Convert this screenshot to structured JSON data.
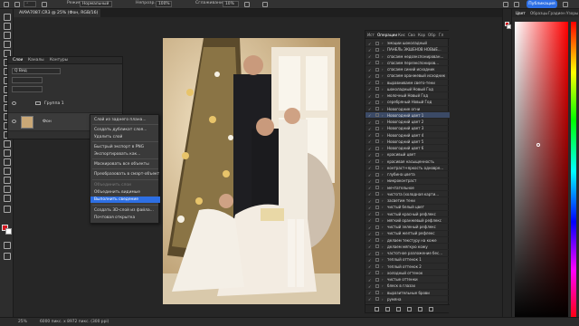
{
  "optionsbar": {
    "mode_label": "Режим:",
    "mode_value": "Нормальный",
    "opacity_label": "Непрозр.:",
    "opacity_value": "100%",
    "smooth_label": "Сглаживание:",
    "smooth_value": "10%",
    "publish_label": "Публикация"
  },
  "document": {
    "tab_title": "AV9A7087.CR3 @ 25% (Фон, RGB/16) *"
  },
  "layers_panel": {
    "tabs": [
      "Слои",
      "Каналы",
      "Контуры"
    ],
    "filter": "Q Вид",
    "rows": [
      {
        "name": "Группа 1"
      },
      {
        "name": "Фон"
      }
    ]
  },
  "context_menu": {
    "items": [
      {
        "label": "Слой из заднего плана...",
        "disabled": false
      },
      {
        "label": "Создать дубликат слоя...",
        "disabled": false
      },
      {
        "label": "Удалить слой",
        "disabled": false
      },
      {
        "label": "Быстрый экспорт в PNG",
        "disabled": false
      },
      {
        "label": "Экспортировать как...",
        "disabled": false
      },
      {
        "label": "Маскировать все объекты",
        "disabled": false
      },
      {
        "label": "Преобразовать в смарт-объект",
        "disabled": false
      },
      {
        "label": "Объединить слои",
        "disabled": true
      },
      {
        "label": "Объединить видимые",
        "disabled": false
      },
      {
        "label": "Выполнить сведение",
        "disabled": false,
        "highlighted": true
      },
      {
        "label": "Создать 3D-слой из файла...",
        "disabled": false
      },
      {
        "label": "Почтовая открытка",
        "disabled": false
      }
    ]
  },
  "actions_panel": {
    "tabs": [
      "Ист",
      "Операции",
      "Кис",
      "Сво",
      "Кор",
      "Обр",
      "Гл"
    ],
    "items": [
      {
        "label": "эмоции шоколадный",
        "arrow": "›",
        "selected": false
      },
      {
        "label": "ПАНЕЛЬ ЭКШЕНОВ НОВЫЕ...",
        "arrow": "⌄",
        "selected": false
      },
      {
        "label": "спасаем недоэкспонирован...",
        "arrow": "›",
        "selected": false
      },
      {
        "label": "спасаем переэкспониров...",
        "arrow": "›",
        "selected": false
      },
      {
        "label": "спасаем синий исходник",
        "arrow": "›",
        "selected": false
      },
      {
        "label": "спасаем оранжевый исходник",
        "arrow": "›",
        "selected": false
      },
      {
        "label": "выравниваем свето-тени",
        "arrow": "›",
        "selected": false
      },
      {
        "label": "шоколадный Новый Год",
        "arrow": "›",
        "selected": false
      },
      {
        "label": "молочный Новый Год",
        "arrow": "›",
        "selected": false
      },
      {
        "label": "серебряный Новый Год",
        "arrow": "›",
        "selected": false
      },
      {
        "label": "Новогодние огни",
        "arrow": "›",
        "selected": false
      },
      {
        "label": "Новогодний цвет 1",
        "arrow": "›",
        "selected": true
      },
      {
        "label": "Новогодний цвет 2",
        "arrow": "›",
        "selected": false
      },
      {
        "label": "Новогодний цвет 3",
        "arrow": "›",
        "selected": false
      },
      {
        "label": "Новогодний цвет 4",
        "arrow": "›",
        "selected": false
      },
      {
        "label": "Новогодний цвет 5",
        "arrow": "›",
        "selected": false
      },
      {
        "label": "Новогодний цвет 6",
        "arrow": "›",
        "selected": false
      },
      {
        "label": "красивый цвет",
        "arrow": "›",
        "selected": false
      },
      {
        "label": "красивая насыщенность",
        "arrow": "›",
        "selected": false
      },
      {
        "label": "контраст+яркость одновре...",
        "arrow": "›",
        "selected": false
      },
      {
        "label": "глубина цвета",
        "arrow": "›",
        "selected": false
      },
      {
        "label": "микроконтраст",
        "arrow": "›",
        "selected": false
      },
      {
        "label": "мечтательное",
        "arrow": "›",
        "selected": false
      },
      {
        "label": "чистота (холодная карти...",
        "arrow": "›",
        "selected": false
      },
      {
        "label": "засветим тени",
        "arrow": "›",
        "selected": false
      },
      {
        "label": "чистый белый цвет",
        "arrow": "›",
        "selected": false
      },
      {
        "label": "чистый красный рефлекс",
        "arrow": "›",
        "selected": false
      },
      {
        "label": "мягкий оранжевый рефлекс",
        "arrow": "›",
        "selected": false
      },
      {
        "label": "чистый зеленый рефлекс",
        "arrow": "›",
        "selected": false
      },
      {
        "label": "чистый желтый рефлекс",
        "arrow": "›",
        "selected": false
      },
      {
        "label": "делаем текстуру на коже",
        "arrow": "›",
        "selected": false
      },
      {
        "label": "делаем мягкую кожу",
        "arrow": "›",
        "selected": false
      },
      {
        "label": "частотное разложение бес...",
        "arrow": "›",
        "selected": false
      },
      {
        "label": "теплый оттенок 1",
        "arrow": "›",
        "selected": false
      },
      {
        "label": "теплый оттенок 2",
        "arrow": "›",
        "selected": false
      },
      {
        "label": "холодный оттенок",
        "arrow": "›",
        "selected": false
      },
      {
        "label": "чистые оттенки",
        "arrow": "›",
        "selected": false
      },
      {
        "label": "блеск в глазах",
        "arrow": "›",
        "selected": false
      },
      {
        "label": "выразительные брови",
        "arrow": "›",
        "selected": false
      },
      {
        "label": "румяна",
        "arrow": "›",
        "selected": false
      },
      {
        "label": "выравниваем кожу",
        "arrow": "›",
        "selected": false
      }
    ]
  },
  "right_dock": {
    "tabs": [
      "Цвет",
      "Образцы",
      "Градиен",
      "Узоры"
    ]
  },
  "statusbar": {
    "zoom": "25%",
    "doc_info": "6000 пикс. x 8972 пикс. (300 ppi)"
  },
  "colors": {
    "foreground": "#d2151f",
    "background": "#ffffff",
    "accent": "#2d6fe4"
  }
}
